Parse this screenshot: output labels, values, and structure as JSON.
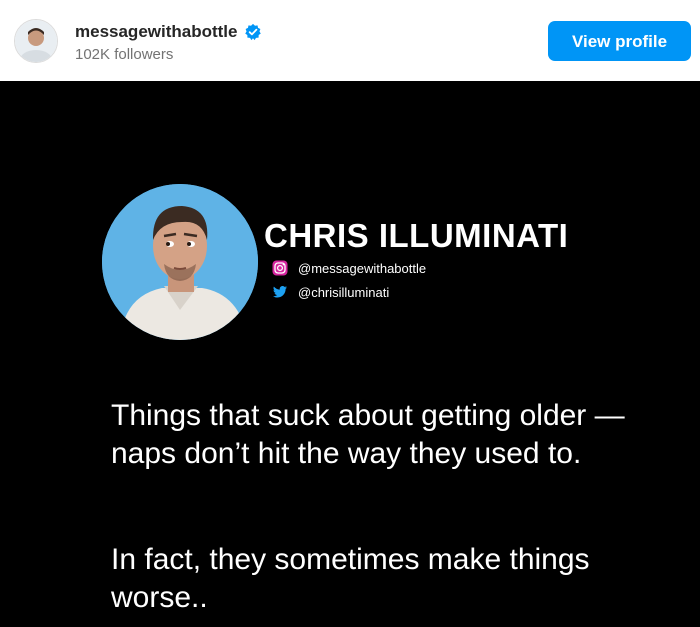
{
  "header": {
    "username": "messagewithabottle",
    "followers": "102K followers",
    "view_profile_label": "View profile",
    "verified_icon": "verified-badge-icon"
  },
  "post": {
    "name": "CHRIS ILLUMINATI",
    "instagram_handle": "@messagewithabottle",
    "twitter_handle": "@chrisilluminati",
    "paragraph1": "Things that suck about getting older — naps don’t hit the way they used to.",
    "paragraph2": "In fact, they sometimes make things worse.."
  },
  "colors": {
    "accent": "#0095f6",
    "post_background": "#000000",
    "avatar_background": "#5fb3e6",
    "twitter": "#1da1f2"
  }
}
